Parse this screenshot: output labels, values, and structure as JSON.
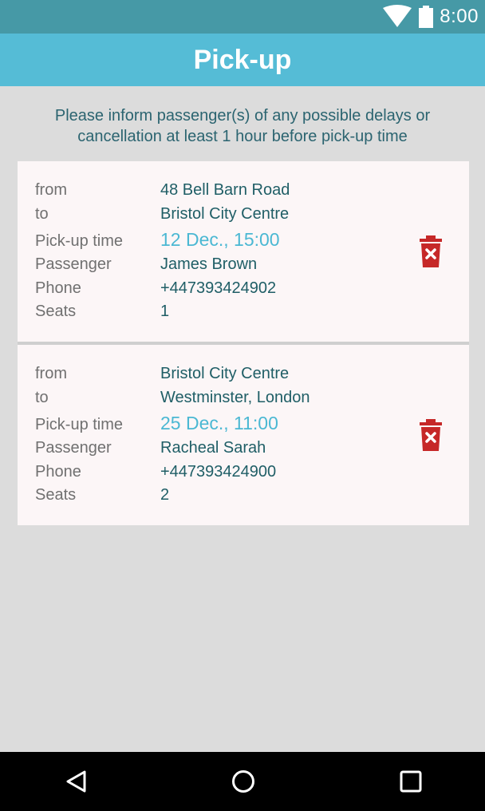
{
  "status_bar": {
    "time": "8:00",
    "icons": [
      "wifi-icon",
      "battery-icon"
    ]
  },
  "app_bar": {
    "title": "Pick-up"
  },
  "notice": {
    "line1": "Please inform passenger(s) of any possible delays or",
    "line2": "cancellation at least 1 hour before pick-up time"
  },
  "labels": {
    "from": "from",
    "to": "to",
    "pickup_time": "Pick-up time",
    "passenger": "Passenger",
    "phone": "Phone",
    "seats": "Seats"
  },
  "bookings": [
    {
      "from": "48 Bell Barn Road",
      "to": "Bristol City Centre",
      "pickup_time": "12 Dec., 15:00",
      "passenger": "James Brown",
      "phone": "+447393424902",
      "seats": "1"
    },
    {
      "from": "Bristol City Centre",
      "to": "Westminster, London",
      "pickup_time": "25 Dec., 11:00",
      "passenger": "Racheal Sarah",
      "phone": "+447393424900",
      "seats": "2"
    }
  ],
  "colors": {
    "status_bar": "#4699a6",
    "app_bar": "#55bcd6",
    "time_accent": "#4bb8d3",
    "delete": "#c62828"
  },
  "nav": {
    "icons": [
      "back-icon",
      "home-icon",
      "recents-icon"
    ]
  }
}
